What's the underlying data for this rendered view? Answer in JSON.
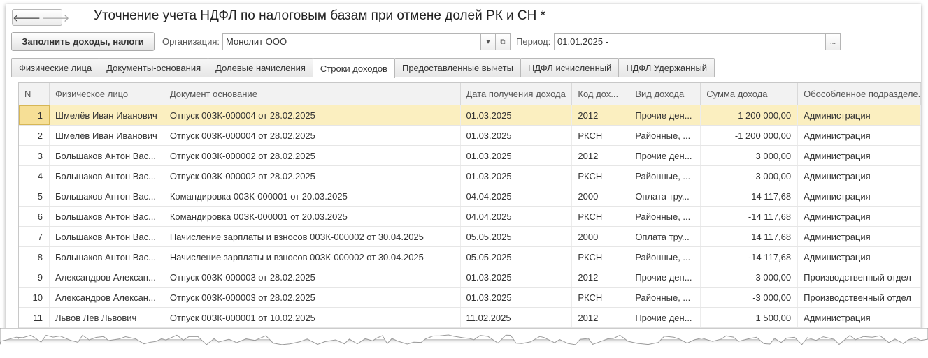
{
  "title": "Уточнение учета НДФЛ по налоговым базам при отмене долей РК и СН *",
  "nav": {
    "back_icon": "arrow-left-icon",
    "forward_icon": "arrow-right-icon",
    "back": "🡐",
    "forward": "🡒"
  },
  "toolbar": {
    "fill_label": "Заполнить доходы, налоги",
    "org_label": "Организация:",
    "org_value": "Монолит ООО",
    "period_label": "Период:",
    "period_value": "01.01.2025 -",
    "dropdown_glyph": "▾",
    "open_glyph": "⧉",
    "choose_glyph": "..."
  },
  "tabs": [
    "Физические лица",
    "Документы-основания",
    "Долевые начисления",
    "Строки доходов",
    "Предоставленные вычеты",
    "НДФЛ исчисленный",
    "НДФЛ Удержанный"
  ],
  "active_tab_index": 3,
  "table": {
    "columns": [
      "N",
      "Физическое лицо",
      "Документ основание",
      "Дата получения дохода",
      "Код дох...",
      "Вид дохода",
      "Сумма дохода",
      "Обособленное подразделе..."
    ],
    "rows": [
      [
        "1",
        "Шмелёв Иван Иванович",
        "Отпуск 00ЗК-000004 от 28.02.2025",
        "01.03.2025",
        "2012",
        "Прочие ден...",
        "1 200 000,00",
        "Администрация"
      ],
      [
        "2",
        "Шмелёв Иван Иванович",
        "Отпуск 00ЗК-000004 от 28.02.2025",
        "01.03.2025",
        "РКСН",
        "Районные, ...",
        "-1 200 000,00",
        "Администрация"
      ],
      [
        "3",
        "Большаков Антон Вас...",
        "Отпуск 00ЗК-000002 от 28.02.2025",
        "01.03.2025",
        "2012",
        "Прочие ден...",
        "3 000,00",
        "Администрация"
      ],
      [
        "4",
        "Большаков Антон Вас...",
        "Отпуск 00ЗК-000002 от 28.02.2025",
        "01.03.2025",
        "РКСН",
        "Районные, ...",
        "-3 000,00",
        "Администрация"
      ],
      [
        "5",
        "Большаков Антон Вас...",
        "Командировка 00ЗК-000001 от 20.03.2025",
        "04.04.2025",
        "2000",
        "Оплата тру...",
        "14 117,68",
        "Администрация"
      ],
      [
        "6",
        "Большаков Антон Вас...",
        "Командировка 00ЗК-000001 от 20.03.2025",
        "04.04.2025",
        "РКСН",
        "Районные, ...",
        "-14 117,68",
        "Администрация"
      ],
      [
        "7",
        "Большаков Антон Вас...",
        "Начисление зарплаты и взносов 00ЗК-000002 от 30.04.2025",
        "05.05.2025",
        "2000",
        "Оплата тру...",
        "14 117,68",
        "Администрация"
      ],
      [
        "8",
        "Большаков Антон Вас...",
        "Начисление зарплаты и взносов 00ЗК-000002 от 30.04.2025",
        "05.05.2025",
        "РКСН",
        "Районные, ...",
        "-14 117,68",
        "Администрация"
      ],
      [
        "9",
        "Александров Алексан...",
        "Отпуск 00ЗК-000003 от 28.02.2025",
        "01.03.2025",
        "2012",
        "Прочие ден...",
        "3 000,00",
        "Производственный отдел"
      ],
      [
        "10",
        "Александров Алексан...",
        "Отпуск 00ЗК-000003 от 28.02.2025",
        "01.03.2025",
        "РКСН",
        "Районные, ...",
        "-3 000,00",
        "Производственный отдел"
      ],
      [
        "11",
        "Львов Лев Львович",
        "Отпуск 00ЗК-000001 от 10.02.2025",
        "11.02.2025",
        "2012",
        "Прочие ден...",
        "1 500,00",
        "Администрация"
      ]
    ],
    "selected_row_index": 0
  }
}
